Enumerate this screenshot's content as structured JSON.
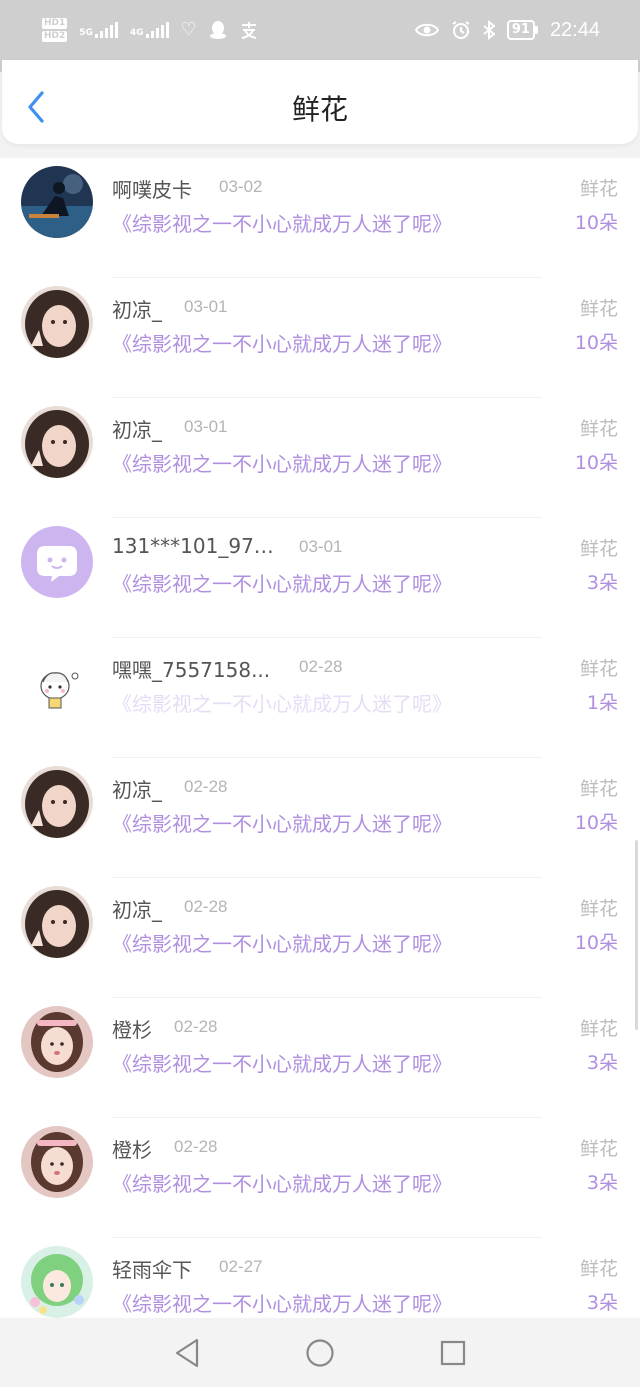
{
  "status_bar": {
    "hd1": "HD1",
    "hd2": "HD2",
    "net1": "5G",
    "net2": "4G",
    "battery": "91",
    "time": "22:44"
  },
  "header": {
    "title": "鲜花"
  },
  "colors": {
    "accent": "#b08fe0",
    "back": "#3d8ff0"
  },
  "items": [
    {
      "name": "啊噗皮卡",
      "date": "03-02",
      "book": "《综影视之一不小心就成万人迷了呢》",
      "gift": "鲜花",
      "count": "10朵"
    },
    {
      "name": "初凉_",
      "date": "03-01",
      "book": "《综影视之一不小心就成万人迷了呢》",
      "gift": "鲜花",
      "count": "10朵"
    },
    {
      "name": "初凉_",
      "date": "03-01",
      "book": "《综影视之一不小心就成万人迷了呢》",
      "gift": "鲜花",
      "count": "10朵"
    },
    {
      "name": "131***101_973...",
      "date": "03-01",
      "book": "《综影视之一不小心就成万人迷了呢》",
      "gift": "鲜花",
      "count": "3朵"
    },
    {
      "name": "嘿嘿_7557158...",
      "date": "02-28",
      "book": "《综影视之一不小心就成万人迷了呢》",
      "gift": "鲜花",
      "count": "1朵"
    },
    {
      "name": "初凉_",
      "date": "02-28",
      "book": "《综影视之一不小心就成万人迷了呢》",
      "gift": "鲜花",
      "count": "10朵"
    },
    {
      "name": "初凉_",
      "date": "02-28",
      "book": "《综影视之一不小心就成万人迷了呢》",
      "gift": "鲜花",
      "count": "10朵"
    },
    {
      "name": "橙杉",
      "date": "02-28",
      "book": "《综影视之一不小心就成万人迷了呢》",
      "gift": "鲜花",
      "count": "3朵"
    },
    {
      "name": "橙杉",
      "date": "02-28",
      "book": "《综影视之一不小心就成万人迷了呢》",
      "gift": "鲜花",
      "count": "3朵"
    },
    {
      "name": "轻雨伞下",
      "date": "02-27",
      "book": "《综影视之一不小心就成万人迷了呢》",
      "gift": "鲜花",
      "count": "3朵"
    }
  ]
}
